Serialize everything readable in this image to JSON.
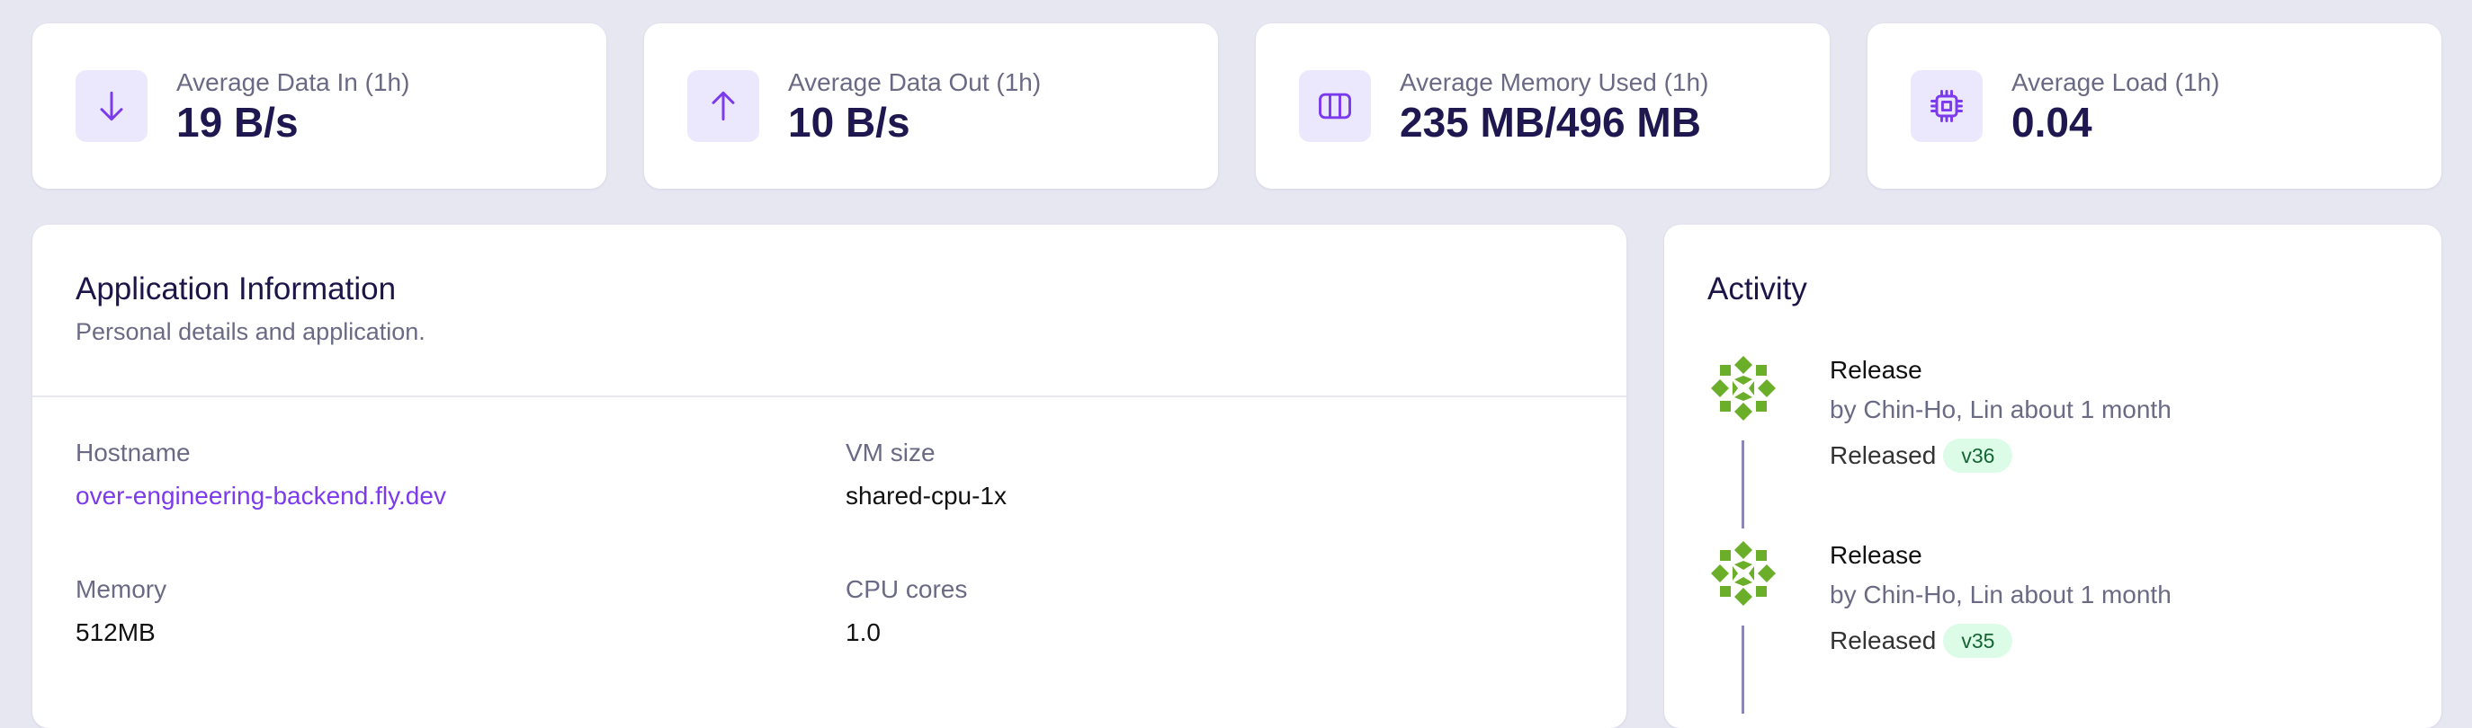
{
  "stats": [
    {
      "label": "Average Data In (1h)",
      "value": "19 B/s",
      "icon": "arrow-down-icon"
    },
    {
      "label": "Average Data Out (1h)",
      "value": "10 B/s",
      "icon": "arrow-up-icon"
    },
    {
      "label": "Average Memory Used (1h)",
      "value": "235 MB/496 MB",
      "icon": "memory-columns-icon"
    },
    {
      "label": "Average Load (1h)",
      "value": "0.04",
      "icon": "cpu-chip-icon"
    }
  ],
  "app_info": {
    "title": "Application Information",
    "subtitle": "Personal details and application.",
    "fields": [
      {
        "label": "Hostname",
        "value": "over-engineering-backend.fly.dev"
      },
      {
        "label": "VM size",
        "value": "shared-cpu-1x"
      },
      {
        "label": "Memory",
        "value": "512MB"
      },
      {
        "label": "CPU cores",
        "value": "1.0"
      }
    ]
  },
  "activity": {
    "title": "Activity",
    "items": [
      {
        "name": "Release",
        "by": "by Chin-Ho, Lin about 1 month",
        "status": "Released",
        "version": "v36"
      },
      {
        "name": "Release",
        "by": "by Chin-Ho, Lin about 1 month",
        "status": "Released",
        "version": "v35"
      }
    ]
  },
  "colors": {
    "accent": "#7c3aed",
    "icon_bg": "#ebe8fd",
    "page_bg": "#e7e7f2",
    "badge_bg": "#dcfce7",
    "avatar_green": "#6aae2a"
  }
}
